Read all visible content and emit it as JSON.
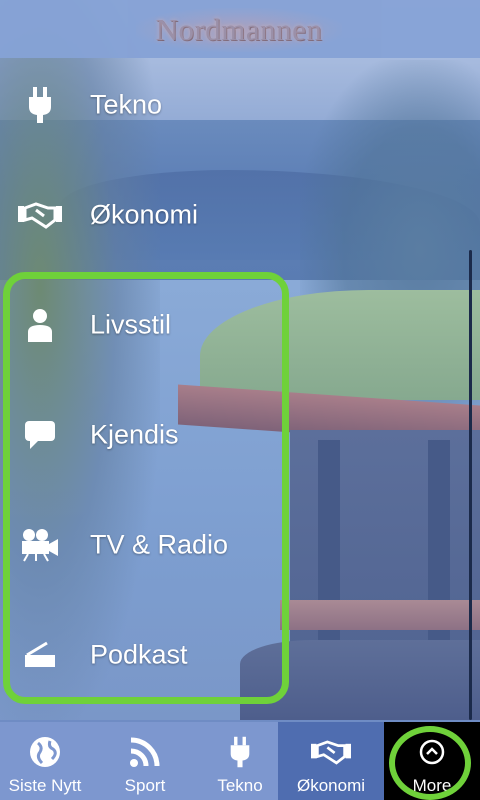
{
  "app": {
    "logo_text": "Nordmannen"
  },
  "menu": {
    "items": [
      {
        "label": "Tekno",
        "icon": "plug-icon"
      },
      {
        "label": "Økonomi",
        "icon": "handshake-icon"
      },
      {
        "label": "Livsstil",
        "icon": "person-icon"
      },
      {
        "label": "Kjendis",
        "icon": "speech-bubble-icon"
      },
      {
        "label": "TV & Radio",
        "icon": "video-camera-icon"
      },
      {
        "label": "Podkast",
        "icon": "podcast-icon"
      }
    ]
  },
  "tabbar": {
    "tabs": [
      {
        "label": "Siste Nytt",
        "icon": "globe-icon"
      },
      {
        "label": "Sport",
        "icon": "rss-icon"
      },
      {
        "label": "Tekno",
        "icon": "plug-icon"
      },
      {
        "label": "Økonomi",
        "icon": "handshake-icon",
        "active": true
      },
      {
        "label": "More",
        "icon": "chevron-up-circle-icon"
      }
    ]
  },
  "colors": {
    "highlight": "#6fd13a",
    "tab_active": "#4f6db0",
    "more_tab": "#000000"
  }
}
